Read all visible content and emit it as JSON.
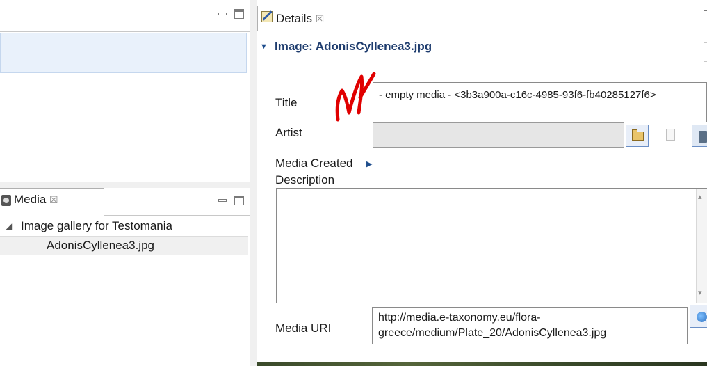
{
  "left_panel": {
    "media_view": {
      "tab_label": "Media",
      "tab_close": "☒",
      "tree": {
        "root_label": "Image gallery for Testomania",
        "toggle_glyph": "◢",
        "child_label": "AdonisCyllenea3.jpg"
      }
    }
  },
  "details_view": {
    "tab_label": "Details",
    "tab_close": "☒",
    "section": {
      "toggle_glyph": "▼",
      "title": "Image: AdonisCyllenea3.jpg"
    },
    "fields": {
      "title_label": "Title",
      "title_value": "- empty media - <3b3a900a-c16c-4985-93f6-fb40285127f6>",
      "artist_label": "Artist",
      "artist_value": "",
      "media_created_label": "Media Created",
      "media_created_arrow": "▶",
      "description_label": "Description",
      "description_value": "",
      "media_uri_label": "Media URI",
      "media_uri_value": "http://media.e-taxonomy.eu/flora-greece/medium/Plate_20/AdonisCyllenea3.jpg"
    },
    "scrollbar": {
      "up_glyph": "▴",
      "down_glyph": "▾"
    }
  },
  "colors": {
    "selection": "#e9f1fb",
    "section_title": "#1e3c6e",
    "annotation_scribble": "#e00000"
  },
  "icons": [
    "minimize-icon",
    "maximize-icon",
    "camera-icon",
    "edit-icon",
    "folder-open-icon",
    "copy-icon",
    "trash-icon",
    "globe-icon"
  ]
}
